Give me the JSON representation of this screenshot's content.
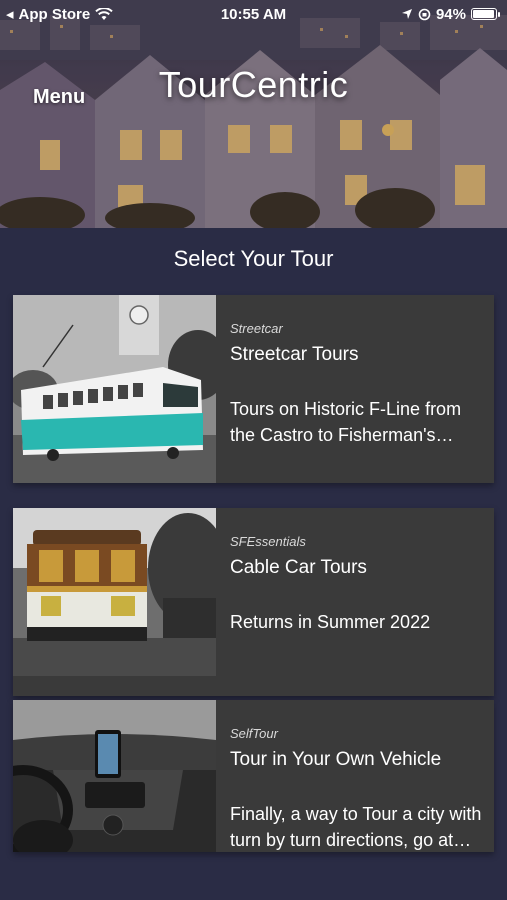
{
  "status_bar": {
    "back_app": "App Store",
    "time": "10:55 AM",
    "battery": "94%",
    "battery_level": 0.94
  },
  "header": {
    "menu_label": "Menu",
    "app_title": "TourCentric"
  },
  "section": {
    "title": "Select Your Tour"
  },
  "tours": [
    {
      "category": "Streetcar",
      "title": "Streetcar Tours",
      "description": "Tours on Historic F-Line from the Castro to Fisherman's Wharf",
      "image_icon": "streetcar-photo"
    },
    {
      "category": "SFEssentials",
      "title": "Cable Car Tours",
      "description": "Returns in Summer 2022",
      "image_icon": "cable-car-photo"
    },
    {
      "category": "SelfTour",
      "title": "Tour in Your Own Vehicle",
      "description": "Finally, a way to Tour a city with turn by turn directions, go at your own pace",
      "image_icon": "car-dashboard-photo"
    }
  ],
  "colors": {
    "background": "#2a2c45",
    "card": "#3a3a3a",
    "streetcar_accent": "#2ab7b0"
  }
}
